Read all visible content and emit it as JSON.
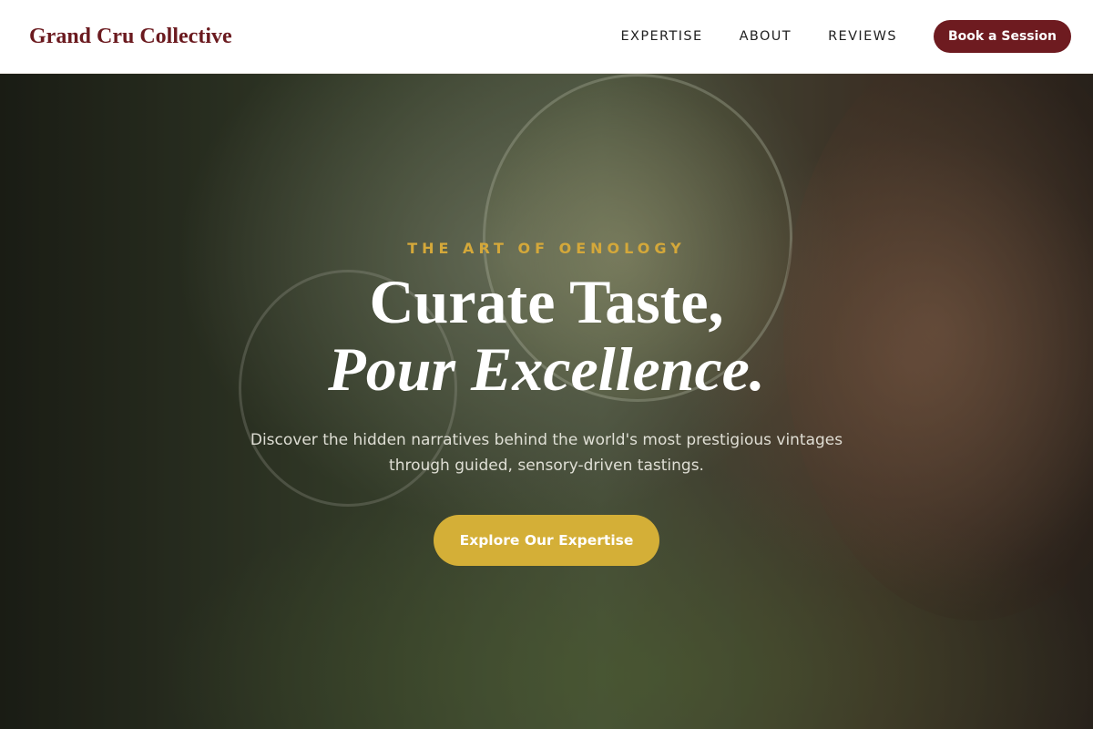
{
  "brand": {
    "name": "Grand Cru Collective",
    "color": "#6b1a1f"
  },
  "nav": {
    "links": [
      "EXPERTISE",
      "ABOUT",
      "REVIEWS"
    ],
    "cta_label": "Book a Session"
  },
  "hero": {
    "eyebrow": "THE ART OF OENOLOGY",
    "headline_line1": "Curate Taste,",
    "headline_line2": "Pour Excellence.",
    "subtitle": "Discover the hidden narratives behind the world's most prestigious vintages through guided, sensory-driven tastings.",
    "cta_label": "Explore Our Expertise"
  },
  "colors": {
    "accent_gold": "#d4af37",
    "wine": "#6e1b20"
  }
}
